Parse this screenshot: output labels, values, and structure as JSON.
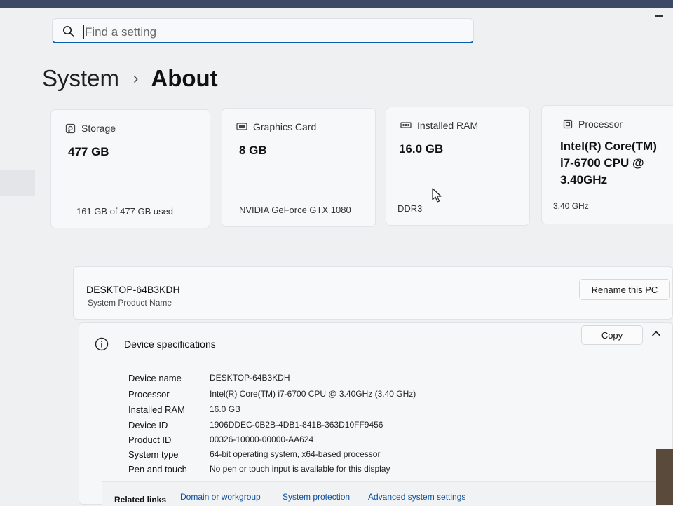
{
  "search": {
    "placeholder": "Find a setting"
  },
  "breadcrumb": {
    "parent": "System",
    "separator": "›",
    "current": "About"
  },
  "cards": [
    {
      "icon": "hard-drive-icon",
      "title": "Storage",
      "value": "477 GB",
      "detail": "161 GB of 477 GB used"
    },
    {
      "icon": "graphics-card-icon",
      "title": "Graphics Card",
      "value": "8 GB",
      "detail": "NVIDIA GeForce GTX 1080"
    },
    {
      "icon": "ram-icon",
      "title": "Installed RAM",
      "value": "16.0 GB",
      "detail": "DDR3"
    },
    {
      "icon": "processor-icon",
      "title": "Processor",
      "value_lines": [
        "Intel(R) Core(TM)",
        "i7-6700 CPU @",
        "3.40GHz"
      ],
      "detail": "3.40 GHz"
    }
  ],
  "pc": {
    "name": "DESKTOP-64B3KDH",
    "subtitle": "System Product Name",
    "rename_label": "Rename this PC"
  },
  "device_specs": {
    "title": "Device specifications",
    "copy_label": "Copy",
    "rows": [
      {
        "label": "Device name",
        "value": "DESKTOP-64B3KDH"
      },
      {
        "label": "Processor",
        "value": "Intel(R) Core(TM) i7-6700 CPU @ 3.40GHz (3.40 GHz)"
      },
      {
        "label": "Installed RAM",
        "value": "16.0 GB"
      },
      {
        "label": "Device ID",
        "value": "1906DDEC-0B2B-4DB1-841B-363D10FF9456"
      },
      {
        "label": "Product ID",
        "value": "00326-10000-00000-AA624"
      },
      {
        "label": "System type",
        "value": "64-bit operating system, x64-based processor"
      },
      {
        "label": "Pen and touch",
        "value": "No pen or touch input is available for this display"
      }
    ]
  },
  "related_links": {
    "label": "Related links",
    "links": [
      "Domain or workgroup",
      "System protection",
      "Advanced system settings"
    ]
  },
  "colors": {
    "accent": "#0a5ca8",
    "link": "#0b4f9c",
    "background": "#eef0f2",
    "card": "#f7f8f9"
  }
}
